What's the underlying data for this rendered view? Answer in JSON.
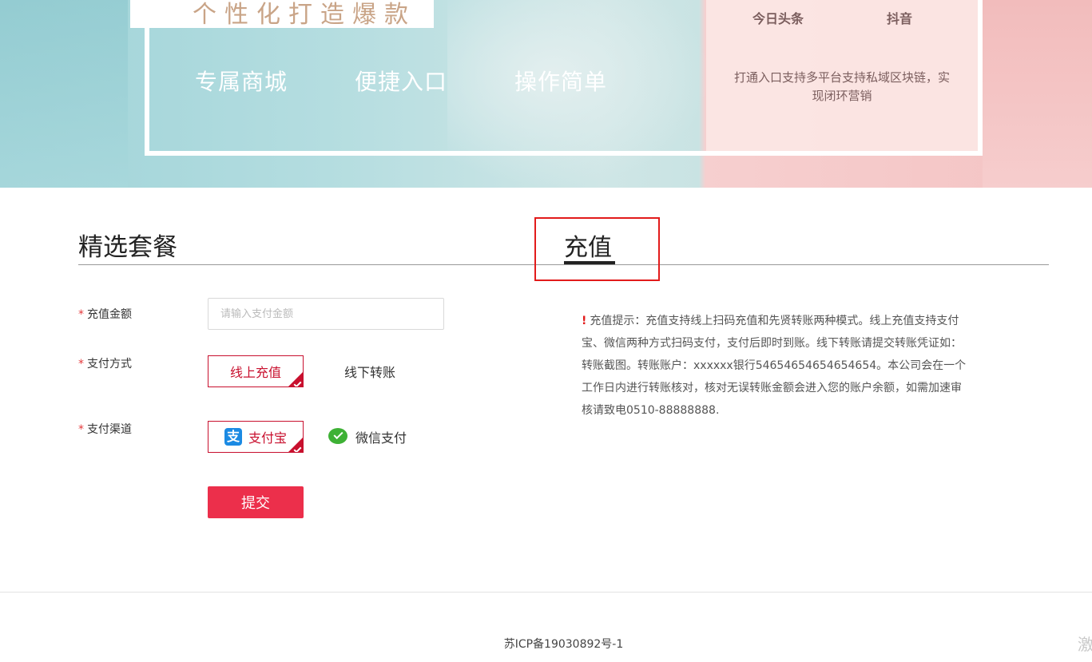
{
  "banner": {
    "tagline": "个性化打造爆款",
    "features": [
      "专属商城",
      "便捷入口",
      "操作简单"
    ],
    "platforms": [
      "今日头条",
      "抖音"
    ],
    "platform_desc": "打通入口支持多平台支持私域区块链，实现闭环营销"
  },
  "section": {
    "title": "精选套餐",
    "active_tab": "充值"
  },
  "form": {
    "amount_label": "充值金额",
    "amount_placeholder": "请输入支付金额",
    "amount_value": "",
    "method_label": "支付方式",
    "methods": [
      {
        "label": "线上充值",
        "selected": true
      },
      {
        "label": "线下转账",
        "selected": false
      }
    ],
    "channel_label": "支付渠道",
    "channels": [
      {
        "label": "支付宝",
        "icon": "alipay-icon",
        "selected": true
      },
      {
        "label": "微信支付",
        "icon": "wechat-icon",
        "selected": false
      }
    ],
    "submit_label": "提交",
    "required_mark": "*"
  },
  "tip": {
    "mark": "!",
    "text": "充值提示：充值支持线上扫码充值和先贤转账两种模式。线上充值支持支付宝、微信两种方式扫码支付，支付后即时到账。线下转账请提交转账凭证如：转账截图。转账账户：xxxxxx银行54654654654654654。本公司会在一个工作日内进行转账核对，核对无误转账金额会进入您的账户余额，如需加速审核请致电0510-88888888."
  },
  "footer": {
    "icp": "苏ICP备19030892号-1",
    "corner_text": "激"
  },
  "colors": {
    "accent": "#ec2f4b",
    "selected_border": "#c8102e",
    "highlight_box": "#e21b1b"
  }
}
